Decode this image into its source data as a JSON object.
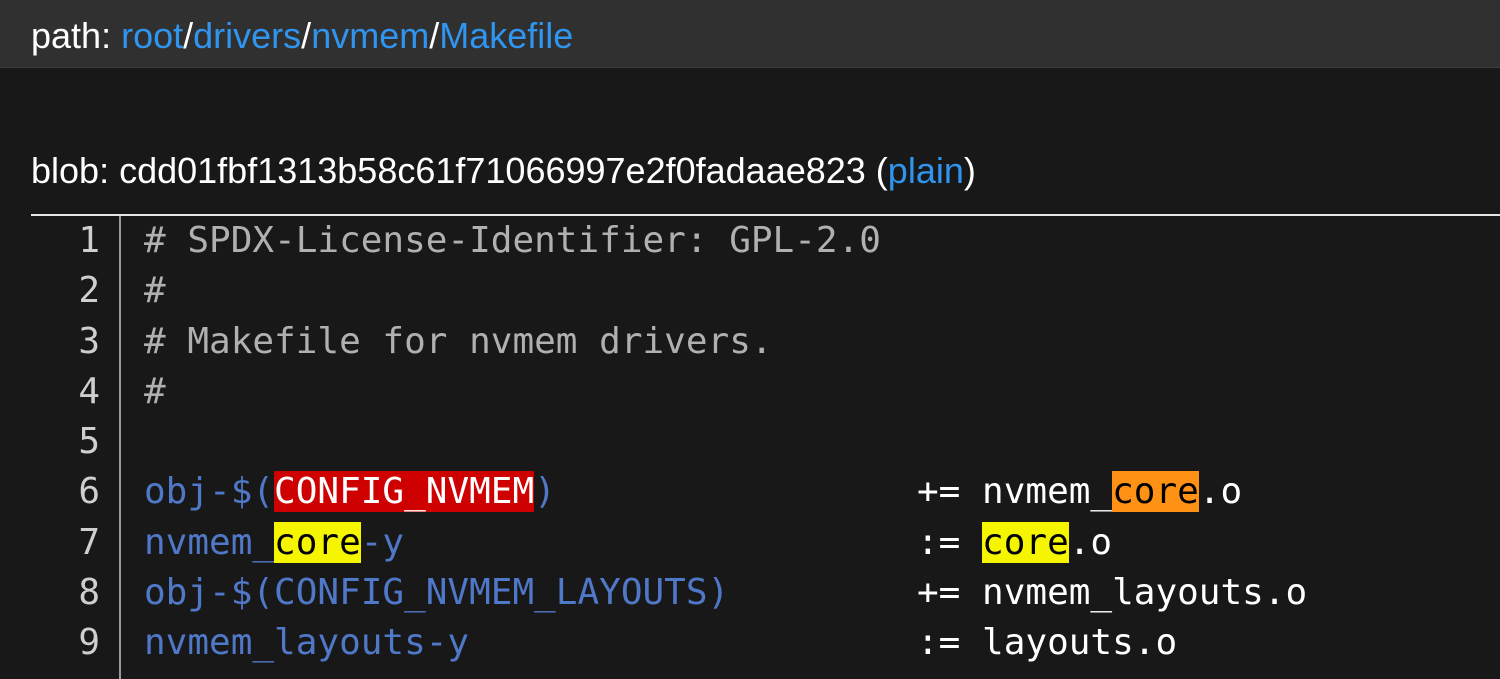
{
  "path": {
    "label": "path: ",
    "segments": [
      "root",
      "drivers",
      "nvmem",
      "Makefile"
    ],
    "separator": "/"
  },
  "blob": {
    "label": "blob: ",
    "hash": "cdd01fbf1313b58c61f71066997e2f0fadaae823",
    "open_paren": " (",
    "plain_label": "plain",
    "close_paren": ")"
  },
  "colors": {
    "link": "#2f95ee",
    "variable": "#5078c8",
    "highlight_red": "#cf0000",
    "highlight_yellow": "#f5f500",
    "highlight_orange": "#ff9214"
  },
  "code": {
    "lines": [
      {
        "num": "1",
        "comment": "# SPDX-License-Identifier: GPL-2.0"
      },
      {
        "num": "2",
        "comment": "#"
      },
      {
        "num": "3",
        "comment": "# Makefile for nvmem drivers."
      },
      {
        "num": "4",
        "comment": "#"
      },
      {
        "num": "5"
      },
      {
        "num": "6",
        "lhs_prefix": "obj-$(",
        "lhs_hl": "CONFIG_NVMEM",
        "lhs_suffix": ")",
        "op": "+=",
        "rhs_prefix": "nvmem_",
        "rhs_hl": "core",
        "rhs_suffix": ".o"
      },
      {
        "num": "7",
        "lhs_prefix": "nvmem_",
        "lhs_hl": "core",
        "lhs_suffix": "-y",
        "op": ":=",
        "rhs_prefix": "",
        "rhs_hl": "core",
        "rhs_suffix": ".o"
      },
      {
        "num": "8",
        "lhs": "obj-$(CONFIG_NVMEM_LAYOUTS)",
        "op": "+=",
        "rhs": "nvmem_layouts.o"
      },
      {
        "num": "9",
        "lhs": "nvmem_layouts-y",
        "op": ":=",
        "rhs": "layouts.o"
      }
    ]
  }
}
